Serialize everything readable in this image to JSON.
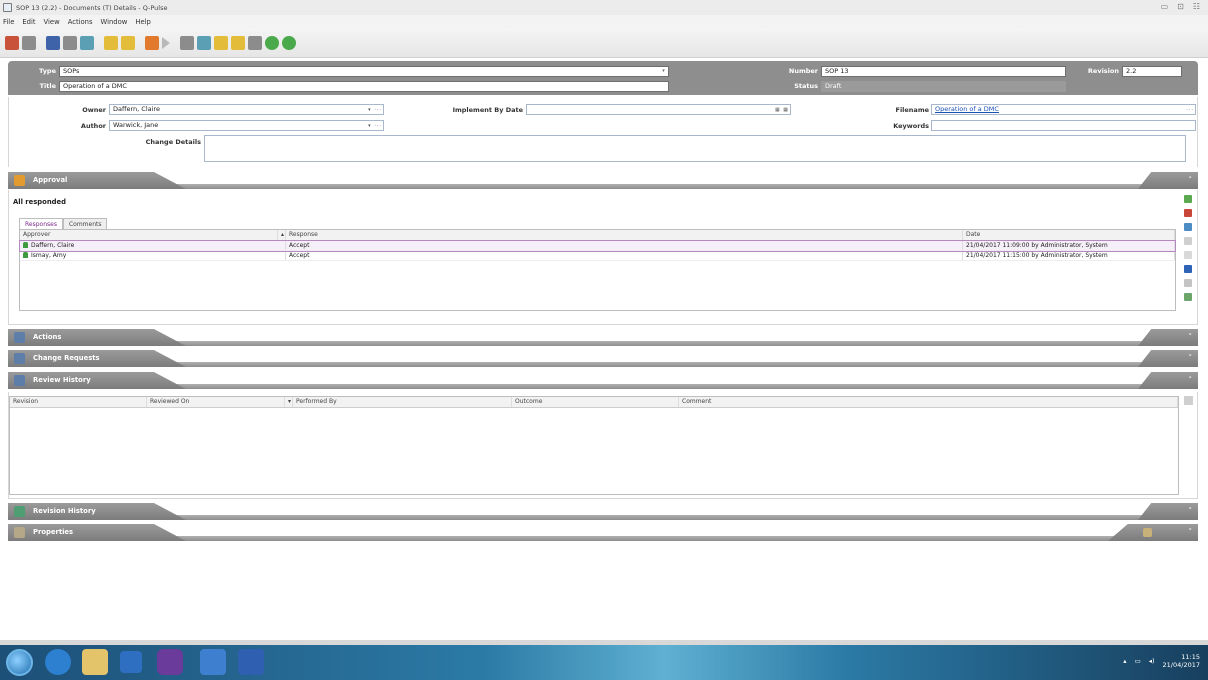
{
  "window": {
    "title": "SOP 13 (2.2) - Documents (T) Details - Q-Pulse",
    "controls": [
      "▭",
      "⊡",
      "☷"
    ]
  },
  "menu": [
    "File",
    "Edit",
    "View",
    "Actions",
    "Window",
    "Help"
  ],
  "toolbar": {
    "icons": [
      "new-icon",
      "grid-icon",
      "save-icon",
      "print-icon",
      "preview-icon",
      "doc-icon",
      "export-icon",
      "user-icon",
      "play-icon",
      "assign-icon",
      "list-icon",
      "folder-icon",
      "note-icon",
      "tag-icon",
      "back-icon",
      "forward-icon"
    ]
  },
  "header": {
    "type_label": "Type",
    "type_value": "SOPs",
    "title_label": "Title",
    "title_value": "Operation of a DMC",
    "number_label": "Number",
    "number_value": "SOP 13",
    "status_label": "Status",
    "status_value": "Draft",
    "revision_label": "Revision",
    "revision_value": "2.2"
  },
  "form": {
    "owner_label": "Owner",
    "owner_value": "Daffern, Claire",
    "author_label": "Author",
    "author_value": "Warwick, Jane",
    "change_details_label": "Change Details",
    "change_details_value": "",
    "implement_label": "Implement By Date",
    "implement_value": "",
    "filename_label": "Filename",
    "filename_value": "Operation of a DMC",
    "keywords_label": "Keywords",
    "keywords_value": ""
  },
  "sections": {
    "approval": "Approval",
    "actions": "Actions",
    "change_requests": "Change Requests",
    "review_history": "Review History",
    "revision_history": "Revision History",
    "properties": "Properties"
  },
  "approval": {
    "status": "All responded",
    "tabs": [
      "Responses",
      "Comments"
    ],
    "columns": [
      "Approver",
      "Response",
      "Date"
    ],
    "rows": [
      {
        "approver": "Daffern, Claire",
        "response": "Accept",
        "date": "21/04/2017 11:09:00 by Administrator, System"
      },
      {
        "approver": "Ismay, Amy",
        "response": "Accept",
        "date": "21/04/2017 11:15:00 by Administrator, System"
      }
    ]
  },
  "review": {
    "columns": [
      "Revision",
      "Reviewed On",
      "Performed By",
      "Outcome",
      "Comment"
    ]
  },
  "taskbar": {
    "time": "11:15",
    "date": "21/04/2017"
  },
  "colors": {
    "header_grey": "#8e8e8e",
    "section_grey": "#7c7c7c",
    "accent_purple": "#7a2b8a",
    "link_blue": "#1b52b8"
  }
}
